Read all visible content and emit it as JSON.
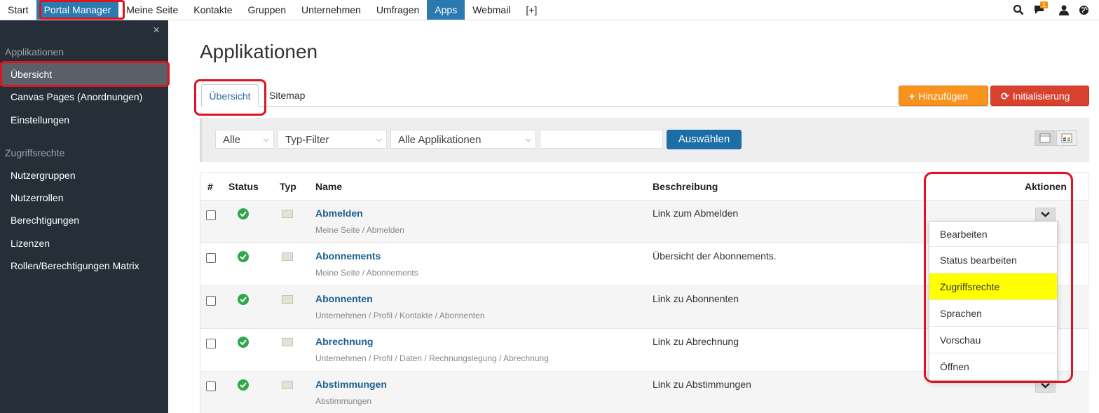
{
  "topnav": {
    "items": [
      "Start",
      "Portal Manager",
      "Meine Seite",
      "Kontakte",
      "Gruppen",
      "Unternehmen",
      "Umfragen",
      "Apps",
      "Webmail",
      "[+]"
    ],
    "chat_badge": "1"
  },
  "sidebar": {
    "close": "×",
    "section1": "Applikationen",
    "section1_items": [
      "Übersicht",
      "Canvas Pages (Anordnungen)",
      "Einstellungen"
    ],
    "section2": "Zugriffsrechte",
    "section2_items": [
      "Nutzergruppen",
      "Nutzerrollen",
      "Berechtigungen",
      "Lizenzen",
      "Rollen/Berechtigungen Matrix"
    ]
  },
  "main": {
    "title": "Applikationen",
    "tabs": [
      "Übersicht",
      "Sitemap"
    ],
    "add_button": "Hinzufügen",
    "init_button": "Initialisierung"
  },
  "filters": {
    "filter1": "Alle",
    "filter2": "Typ-Filter",
    "filter3": "Alle Applikationen",
    "text_value": "",
    "submit": "Auswählen"
  },
  "table": {
    "headers": [
      "#",
      "Status",
      "Typ",
      "Name",
      "Beschreibung",
      "Aktionen"
    ],
    "rows": [
      {
        "name": "Abmelden",
        "path": "Meine Seite / Abmelden",
        "desc": "Link zum Abmelden"
      },
      {
        "name": "Abonnements",
        "path": "Meine Seite / Abonnements",
        "desc": "Übersicht der Abonnements."
      },
      {
        "name": "Abonnenten",
        "path": "Unternehmen / Profil / Kontakte / Abonnenten",
        "desc": "Link zu Abonnenten"
      },
      {
        "name": "Abrechnung",
        "path": "Unternehmen / Profil / Daten / Rechnungslegung / Abrechnung",
        "desc": "Link zu Abrechnung"
      },
      {
        "name": "Abstimmungen",
        "path": "Abstimmungen",
        "desc": "Link zu Abstimmungen"
      }
    ]
  },
  "actions_menu": {
    "items": [
      "Bearbeiten",
      "Status bearbeiten",
      "Zugriffsrechte",
      "Sprachen",
      "Vorschau",
      "Öffnen"
    ],
    "highlight_color": "#ffff00"
  },
  "colors": {
    "accent": "#2a7ab0",
    "sidebar_bg": "#262e38",
    "add": "#f7931e",
    "init": "#d9412f",
    "annotation": "#e0121f"
  }
}
